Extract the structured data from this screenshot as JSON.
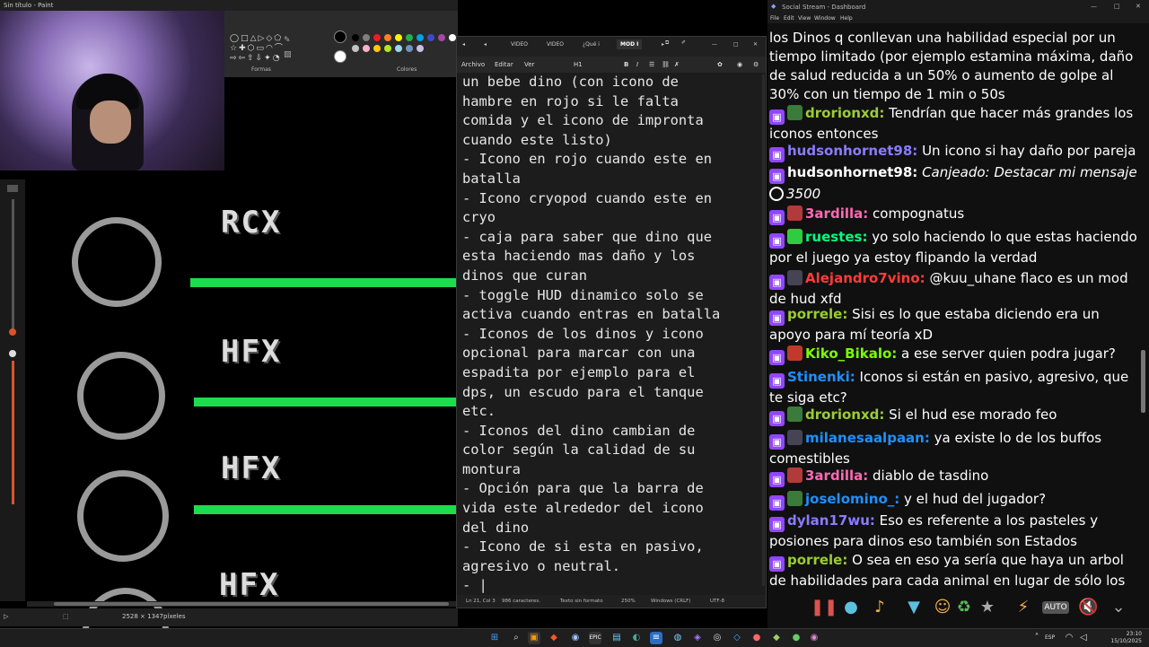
{
  "paint": {
    "title": "Sin título - Paint",
    "ribbon_shapes_label": "Formas",
    "ribbon_colors_label": "Colores",
    "status_size": "2528 × 1347píxeles",
    "bar_labels": [
      "RCX",
      "HFX",
      "HFX",
      "HFX"
    ],
    "swatch_colors": [
      "#000000",
      "#7f7f7f",
      "#ed1c24",
      "#ff7f27",
      "#fff200",
      "#22b14c",
      "#00a2e8",
      "#3f48cc",
      "#a349a4",
      "#ffffff",
      "#c3c3c3",
      "#ffaec9",
      "#ffc90e",
      "#b5e61d",
      "#99d9ea",
      "#7092be",
      "#c8bfe7"
    ],
    "bar_color": "#1ddc4e"
  },
  "notepad": {
    "tabs": [
      "VIDEO",
      "VIDEO",
      "¿Qué i",
      "MOD I"
    ],
    "menu": [
      "Archivo",
      "Editar",
      "Ver"
    ],
    "heading": "H1",
    "text": "un bebe dino (con icono de\nhambre en rojo si le falta\ncomida y el icono de impronta\ncuando este listo)\n- Icono en rojo cuando este en\nbatalla\n- Icono cryopod cuando este en\ncryo\n- caja para saber que dino que\nesta haciendo mas daño y los\ndinos que curan\n- toggle HUD dinamico solo se\nactiva cuando entras en batalla\n- Iconos de los dinos y icono\nopcional para marcar con una\nespadita por ejemplo para el\ndps, un escudo para el tanque\netc.\n- Iconos del dino cambian de\ncolor según la calidad de su\nmontura\n- Opción para que la barra de\nvida este alrededor del icono\ndel dino\n- Icono de si esta en pasivo,\nagresivo o neutral.\n- |",
    "status": {
      "position": "Ln 21, Col 3",
      "chars": "986 caracteres.",
      "format": "Texto sin formato",
      "zoom": "250%",
      "eol": "Windows (CRLF)",
      "encoding": "UTF-8"
    }
  },
  "stream": {
    "title": "Social Stream - Dashboard",
    "menu": [
      "File",
      "Edit",
      "View",
      "Window",
      "Help"
    ],
    "messages": [
      {
        "user": "",
        "text": "los Dinos q conllevan una habilidad especial por un tiempo limitado (por ejemplo estamina máxima, daño de salud reducida a un 50% o aumento de golpe al 30% con un tiempo de 1 min o 50s",
        "color": "#ffffff"
      },
      {
        "user": "drorionxd:",
        "text": "Tendrían que hacer más grandes los iconos entonces",
        "color": "#9acd32"
      },
      {
        "user": "hudsonhornet98:",
        "text": "Un icono si hay daño por pareja",
        "color": "#8a7cff"
      },
      {
        "user": "hudsonhornet98:",
        "text": "Canjeado: Destacar mi mensaje",
        "color": "#ffffff"
      },
      {
        "user": "",
        "text": "3500",
        "color": "#ffffff"
      },
      {
        "user": "3ardilla:",
        "text": "compognatus",
        "color": "#ff69b4"
      },
      {
        "user": "ruestes:",
        "text": "yo solo haciendo lo que estas haciendo por el juego ya estoy flipando la verdad",
        "color": "#00ff7f"
      },
      {
        "user": "Alejandro7vino:",
        "text": "@kuu_uhane flaco es un mod de hud xfd",
        "color": "#ff3b3b"
      },
      {
        "user": "porrele:",
        "text": "Sisi es lo que estaba diciendo era un apoyo para mí teoría xD",
        "color": "#9acd32"
      },
      {
        "user": "Kiko_Bikalo:",
        "text": "a ese server quien podra jugar?",
        "color": "#7cfc00"
      },
      {
        "user": "Stinenki:",
        "text": "Iconos si están en pasivo, agresivo, que te siga etc?",
        "color": "#1e90ff"
      },
      {
        "user": "drorionxd:",
        "text": "Si el hud ese morado feo",
        "color": "#9acd32"
      },
      {
        "user": "milanesaalpaan:",
        "text": "ya existe lo de los buffos comestibles",
        "color": "#1e90ff"
      },
      {
        "user": "3ardilla:",
        "text": "diablo de tasdino",
        "color": "#ff69b4"
      },
      {
        "user": "joselomino_:",
        "text": "y el hud del jugador?",
        "color": "#1e90ff"
      },
      {
        "user": "dylan17wu:",
        "text": "Eso es referente a los pasteles y posiones para dinos eso también son Estados",
        "color": "#8a7cff"
      },
      {
        "user": "porrele:",
        "text": "O sea en eso ya sería que haya un arbol de habilidades para cada animal en lugar de sólo los jugadores",
        "color": "#9acd32"
      }
    ],
    "toolbar_auto": "AUTO"
  },
  "taskbar": {
    "lang": "ESP",
    "time": "23:10",
    "date": "15/10/2025"
  }
}
